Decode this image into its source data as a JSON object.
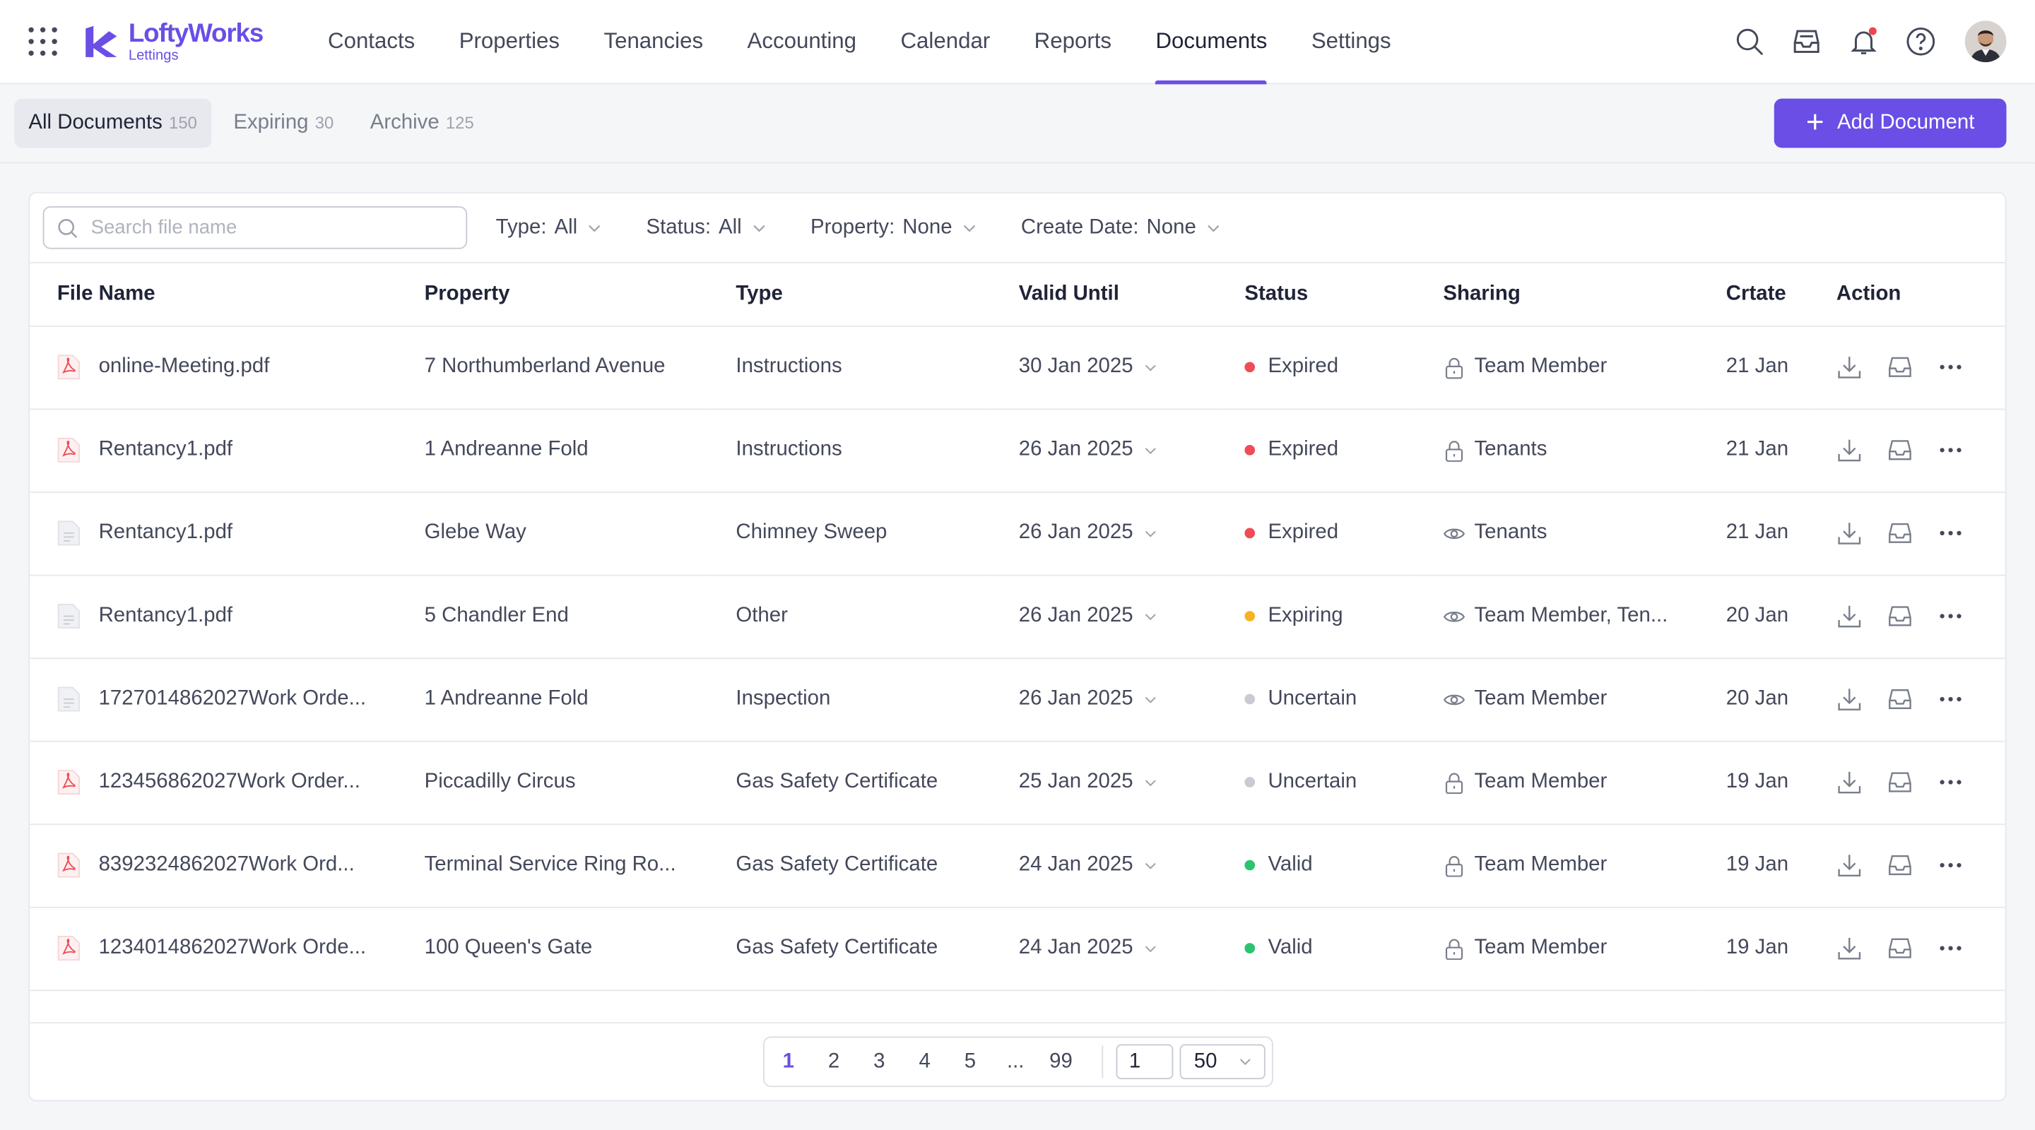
{
  "brand": {
    "name": "LoftyWorks",
    "sub": "Lettings",
    "accent": "#6a4ee6"
  },
  "nav": [
    {
      "label": "Contacts",
      "active": false
    },
    {
      "label": "Properties",
      "active": false
    },
    {
      "label": "Tenancies",
      "active": false
    },
    {
      "label": "Accounting",
      "active": false
    },
    {
      "label": "Calendar",
      "active": false
    },
    {
      "label": "Reports",
      "active": false
    },
    {
      "label": "Documents",
      "active": true
    },
    {
      "label": "Settings",
      "active": false
    }
  ],
  "nav_icons": [
    "search-icon",
    "inbox-icon",
    "bell-icon",
    "help-icon"
  ],
  "subtabs": [
    {
      "label": "All Documents",
      "count": "150",
      "active": true
    },
    {
      "label": "Expiring",
      "count": "30",
      "active": false
    },
    {
      "label": "Archive",
      "count": "125",
      "active": false
    }
  ],
  "add_button": "Add Document",
  "search": {
    "placeholder": "Search file name",
    "value": ""
  },
  "filters": [
    {
      "label": "Type:",
      "value": "All"
    },
    {
      "label": "Status:",
      "value": "All"
    },
    {
      "label": "Property:",
      "value": "None"
    },
    {
      "label": "Create Date:",
      "value": "None"
    }
  ],
  "columns": [
    "File Name",
    "Property",
    "Type",
    "Valid Until",
    "Status",
    "Sharing",
    "Crtate",
    "Action"
  ],
  "status_colors": {
    "Expired": "#ef4c55",
    "Expiring": "#f5b324",
    "Uncertain": "#c9cbd3",
    "Valid": "#2ac46f"
  },
  "rows": [
    {
      "file": "online-Meeting.pdf",
      "icon": "pdf",
      "property": "7 Northumberland Avenue",
      "type": "Instructions",
      "valid": "30 Jan 2025",
      "status": "Expired",
      "share_icon": "lock",
      "sharing": "Team Member",
      "created": "21 Jan"
    },
    {
      "file": "Rentancy1.pdf",
      "icon": "pdf",
      "property": "1 Andreanne Fold",
      "type": "Instructions",
      "valid": "26 Jan 2025",
      "status": "Expired",
      "share_icon": "lock",
      "sharing": "Tenants",
      "created": "21 Jan"
    },
    {
      "file": "Rentancy1.pdf",
      "icon": "doc",
      "property": "Glebe Way",
      "type": "Chimney Sweep",
      "valid": "26 Jan 2025",
      "status": "Expired",
      "share_icon": "eye",
      "sharing": "Tenants",
      "created": "21 Jan"
    },
    {
      "file": "Rentancy1.pdf",
      "icon": "doc",
      "property": "5 Chandler End",
      "type": "Other",
      "valid": "26 Jan 2025",
      "status": "Expiring",
      "share_icon": "eye",
      "sharing": "Team Member, Ten...",
      "created": "20 Jan"
    },
    {
      "file": "1727014862027Work Orde...",
      "icon": "doc",
      "property": "1 Andreanne Fold",
      "type": "Inspection",
      "valid": "26 Jan 2025",
      "status": "Uncertain",
      "share_icon": "eye",
      "sharing": "Team Member",
      "created": "20 Jan"
    },
    {
      "file": "123456862027Work Order...",
      "icon": "pdf",
      "property": "Piccadilly Circus",
      "type": "Gas Safety Certificate",
      "valid": "25 Jan 2025",
      "status": "Uncertain",
      "share_icon": "lock",
      "sharing": "Team Member",
      "created": "19 Jan"
    },
    {
      "file": "8392324862027Work Ord...",
      "icon": "pdf",
      "property": "Terminal Service Ring Ro...",
      "type": "Gas Safety Certificate",
      "valid": "24 Jan 2025",
      "status": "Valid",
      "share_icon": "lock",
      "sharing": "Team Member",
      "created": "19 Jan"
    },
    {
      "file": "1234014862027Work Orde...",
      "icon": "pdf",
      "property": "100 Queen's Gate",
      "type": "Gas Safety Certificate",
      "valid": "24 Jan 2025",
      "status": "Valid",
      "share_icon": "lock",
      "sharing": "Team Member",
      "created": "19 Jan"
    }
  ],
  "pagination": {
    "pages": [
      "1",
      "2",
      "3",
      "4",
      "5",
      "...",
      "99"
    ],
    "current": "1",
    "goto": "1",
    "page_size": "50"
  }
}
